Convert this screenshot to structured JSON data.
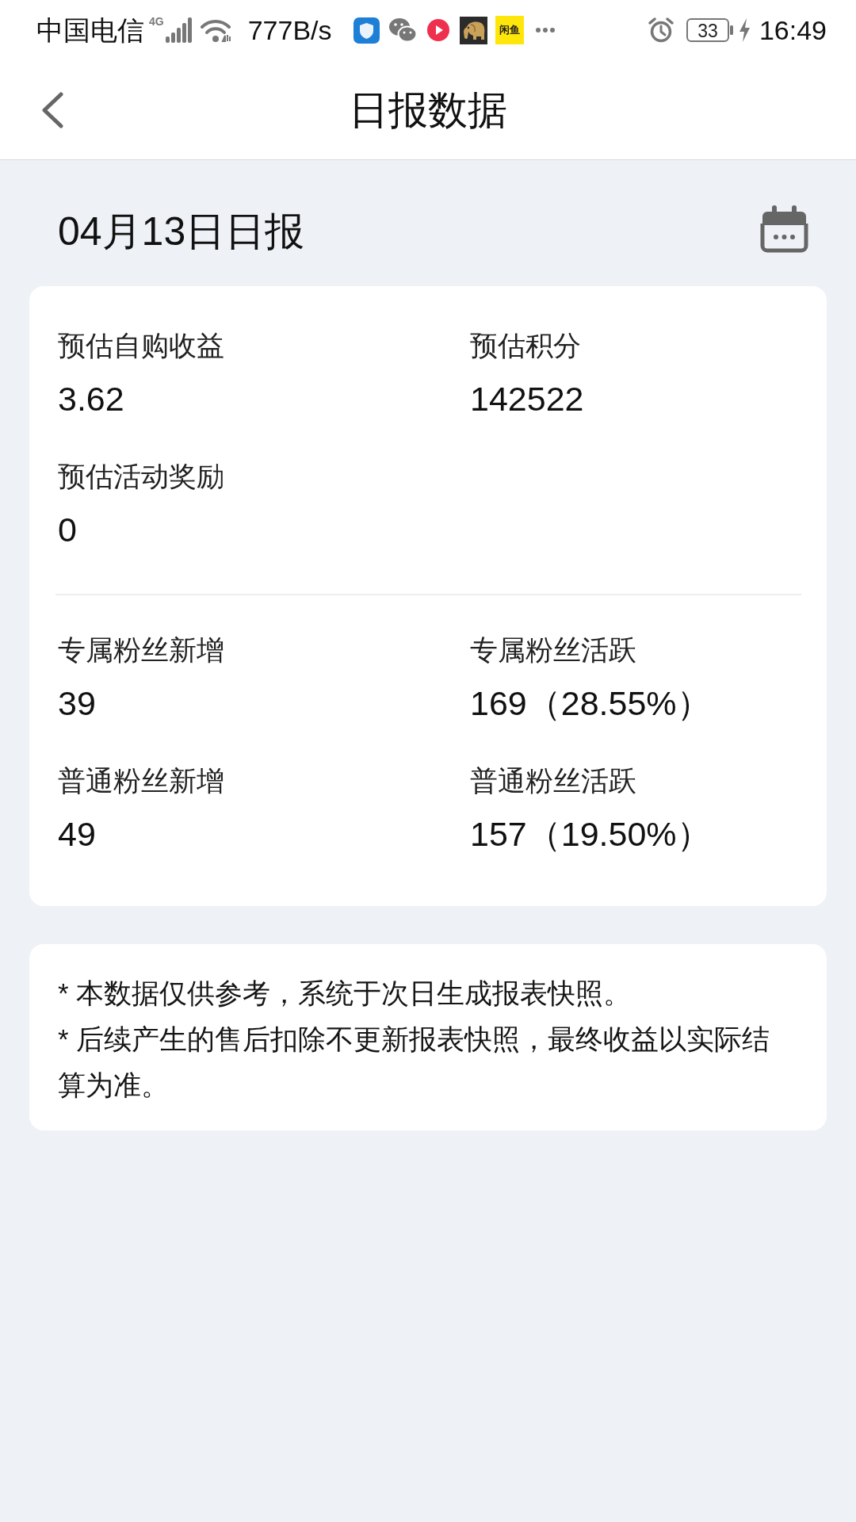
{
  "status_bar": {
    "carrier": "中国电信",
    "network": "4G",
    "speed": "777B/s",
    "notification_icons": [
      {
        "kind": "shield"
      },
      {
        "kind": "chat"
      },
      {
        "kind": "video"
      },
      {
        "kind": "elephant"
      },
      {
        "kind": "tile",
        "label": "闲鱼"
      },
      {
        "kind": "more"
      }
    ],
    "battery": "33",
    "time": "16:49"
  },
  "header": {
    "title": "日报数据"
  },
  "report": {
    "date_title": "04月13日日报"
  },
  "stats_card": {
    "sections": [
      {
        "items": [
          {
            "label": "预估自购收益",
            "value": "3.62"
          },
          {
            "label": "预估积分",
            "value": "142522"
          },
          {
            "label": "预估活动奖励",
            "value": "0"
          }
        ]
      },
      {
        "items": [
          {
            "label": "专属粉丝新增",
            "value": "39"
          },
          {
            "label": "专属粉丝活跃",
            "value": "169（28.55%）"
          },
          {
            "label": "普通粉丝新增",
            "value": "49"
          },
          {
            "label": "普通粉丝活跃",
            "value": "157（19.50%）"
          }
        ]
      }
    ]
  },
  "notes": [
    "* 本数据仅供参考，系统于次日生成报表快照。",
    "* 后续产生的售后扣除不更新报表快照，最终收益以实际结算为准。"
  ]
}
